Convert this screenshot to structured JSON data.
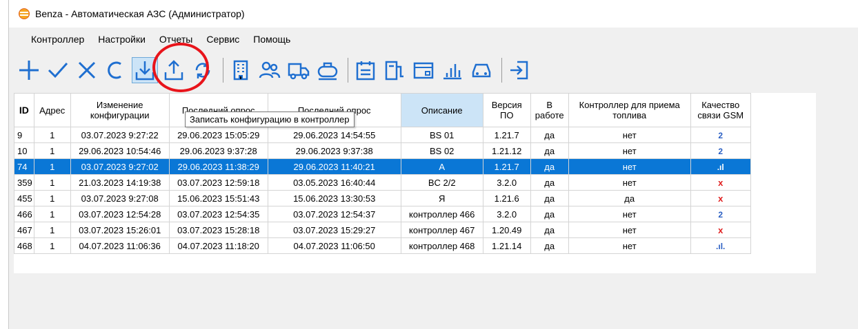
{
  "window": {
    "title": "Benza - Автоматическая АЗС (Администратор)"
  },
  "menu": [
    {
      "label": "Контроллер"
    },
    {
      "label": "Настройки"
    },
    {
      "label": "Отчеты"
    },
    {
      "label": "Сервис"
    },
    {
      "label": "Помощь"
    }
  ],
  "toolbar": {
    "tooltip": "Записать конфигурацию в контроллер"
  },
  "table": {
    "headers": [
      "ID",
      "Адрес",
      "Изменение конфигурации",
      "Последний опрос",
      "Последний опрос",
      "Описание",
      "Версия ПО",
      "В работе",
      "Контроллер для приема топлива",
      "Качество связи GSM"
    ],
    "rows": [
      [
        "9",
        "1",
        "03.07.2023 9:27:22",
        "29.06.2023 15:05:29",
        "29.06.2023 14:54:55",
        "BS 01",
        "1.21.7",
        "да",
        "нет",
        "2"
      ],
      [
        "10",
        "1",
        "29.06.2023 10:54:46",
        "29.06.2023 9:37:28",
        "29.06.2023 9:37:38",
        "BS 02",
        "1.21.12",
        "да",
        "нет",
        "2"
      ],
      [
        "74",
        "1",
        "03.07.2023 9:27:02",
        "29.06.2023 11:38:29",
        "29.06.2023 11:40:21",
        "A",
        "1.21.7",
        "да",
        "нет",
        ".ıl"
      ],
      [
        "359",
        "1",
        "21.03.2023 14:19:38",
        "03.07.2023 12:59:18",
        "03.05.2023 16:40:44",
        "BC 2/2",
        "3.2.0",
        "да",
        "нет",
        "x"
      ],
      [
        "455",
        "1",
        "03.07.2023 9:27:08",
        "15.06.2023 15:51:43",
        "15.06.2023 13:30:53",
        "Я",
        "1.21.6",
        "да",
        "да",
        "x"
      ],
      [
        "466",
        "1",
        "03.07.2023 12:54:28",
        "03.07.2023 12:54:35",
        "03.07.2023 12:54:37",
        "контроллер 466",
        "3.2.0",
        "да",
        "нет",
        "2"
      ],
      [
        "467",
        "1",
        "03.07.2023 15:26:01",
        "03.07.2023 15:28:18",
        "03.07.2023 15:29:27",
        "контроллер 467",
        "1.20.49",
        "да",
        "нет",
        "x"
      ],
      [
        "468",
        "1",
        "04.07.2023 11:06:36",
        "04.07.2023 11:18:20",
        "04.07.2023 11:06:50",
        "контроллер 468",
        "1.21.14",
        "да",
        "нет",
        ".ıl."
      ]
    ],
    "selected_row": 2
  },
  "colors": {
    "accent": "#0a77d6",
    "toolbar_icon": "#1f6fd0",
    "highlight": "#e8141b"
  }
}
